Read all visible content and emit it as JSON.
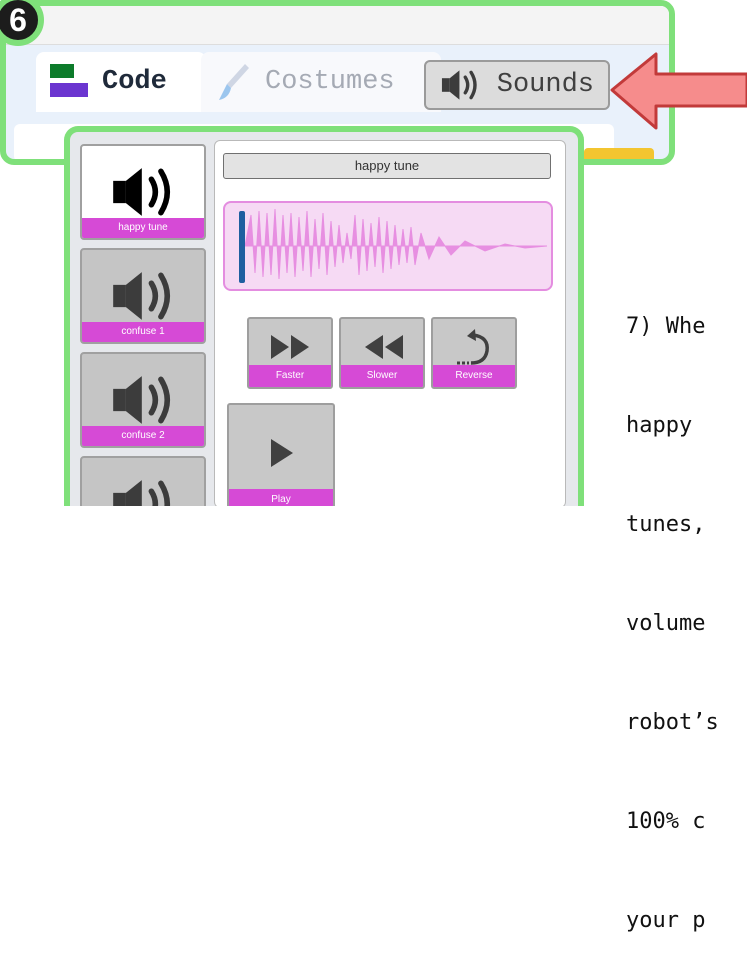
{
  "step_badge": "6",
  "tabs": {
    "code": "Code",
    "costumes": "Costumes",
    "sounds": "Sounds"
  },
  "sound_list": [
    {
      "name": "happy tune",
      "selected": true
    },
    {
      "name": "confuse 1",
      "selected": false
    },
    {
      "name": "confuse 2",
      "selected": false
    },
    {
      "name": "",
      "selected": false
    }
  ],
  "editor": {
    "sound_name": "happy tune",
    "effects": {
      "faster": "Faster",
      "slower": "Slower",
      "reverse": "Reverse",
      "play": "Play"
    }
  },
  "instruction_lines": [
    "7) Whe",
    "happy",
    "tunes,",
    "volume",
    "robot’s",
    "100% c",
    "your p"
  ],
  "colors": {
    "highlight_border": "#7fe07a",
    "label_magenta": "#d64ad6",
    "arrow_fill": "#f68c8c",
    "waveform_fill": "#e78fe1",
    "playhead": "#1e5fa0"
  },
  "icons": {
    "code": "code-blocks-icon",
    "costumes": "paintbrush-icon",
    "sounds": "speaker-icon",
    "faster": "fast-forward-icon",
    "slower": "rewind-icon",
    "reverse": "reverse-icon",
    "play": "play-icon"
  }
}
